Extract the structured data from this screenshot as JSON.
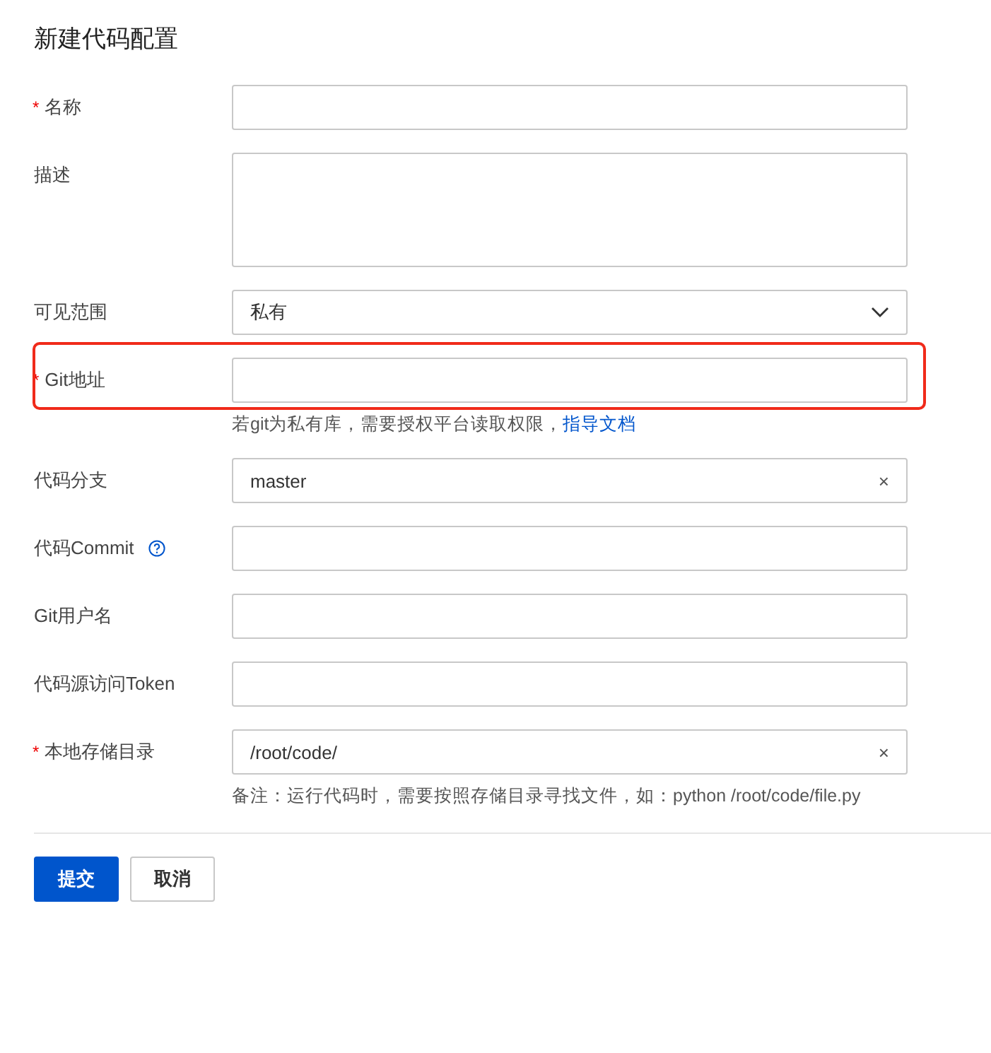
{
  "title": "新建代码配置",
  "required_mark": "*",
  "fields": [
    {
      "kind": "input",
      "label": "名称",
      "required": true,
      "help": false,
      "highlighted": false
    },
    {
      "kind": "textarea",
      "label": "描述",
      "required": false,
      "help": false,
      "highlighted": false
    },
    {
      "kind": "select",
      "label": "可见范围",
      "required": false,
      "help": false,
      "highlighted": false,
      "value": "私有"
    },
    {
      "kind": "input",
      "label": "Git地址",
      "required": true,
      "help": false,
      "highlighted": true,
      "hint": "若git为私有库，需要授权平台读取权限，",
      "hint_link": "指导文档"
    },
    {
      "kind": "clearable",
      "label": "代码分支",
      "required": false,
      "help": false,
      "highlighted": false,
      "value": "master",
      "clear": "×"
    },
    {
      "kind": "input",
      "label": "代码Commit",
      "required": false,
      "help": true,
      "highlighted": false
    },
    {
      "kind": "input",
      "label": "Git用户名",
      "required": false,
      "help": false,
      "highlighted": false
    },
    {
      "kind": "input",
      "label": "代码源访问Token",
      "required": false,
      "help": false,
      "highlighted": false
    },
    {
      "kind": "clearable",
      "label": "本地存储目录",
      "required": true,
      "help": false,
      "highlighted": false,
      "value": "/root/code/",
      "clear": "×",
      "hint": "备注：运行代码时，需要按照存储目录寻找文件，如：python /root/code/file.py"
    }
  ],
  "buttons": [
    {
      "label": "提交",
      "kind": "primary"
    },
    {
      "label": "取消",
      "kind": "default"
    }
  ]
}
